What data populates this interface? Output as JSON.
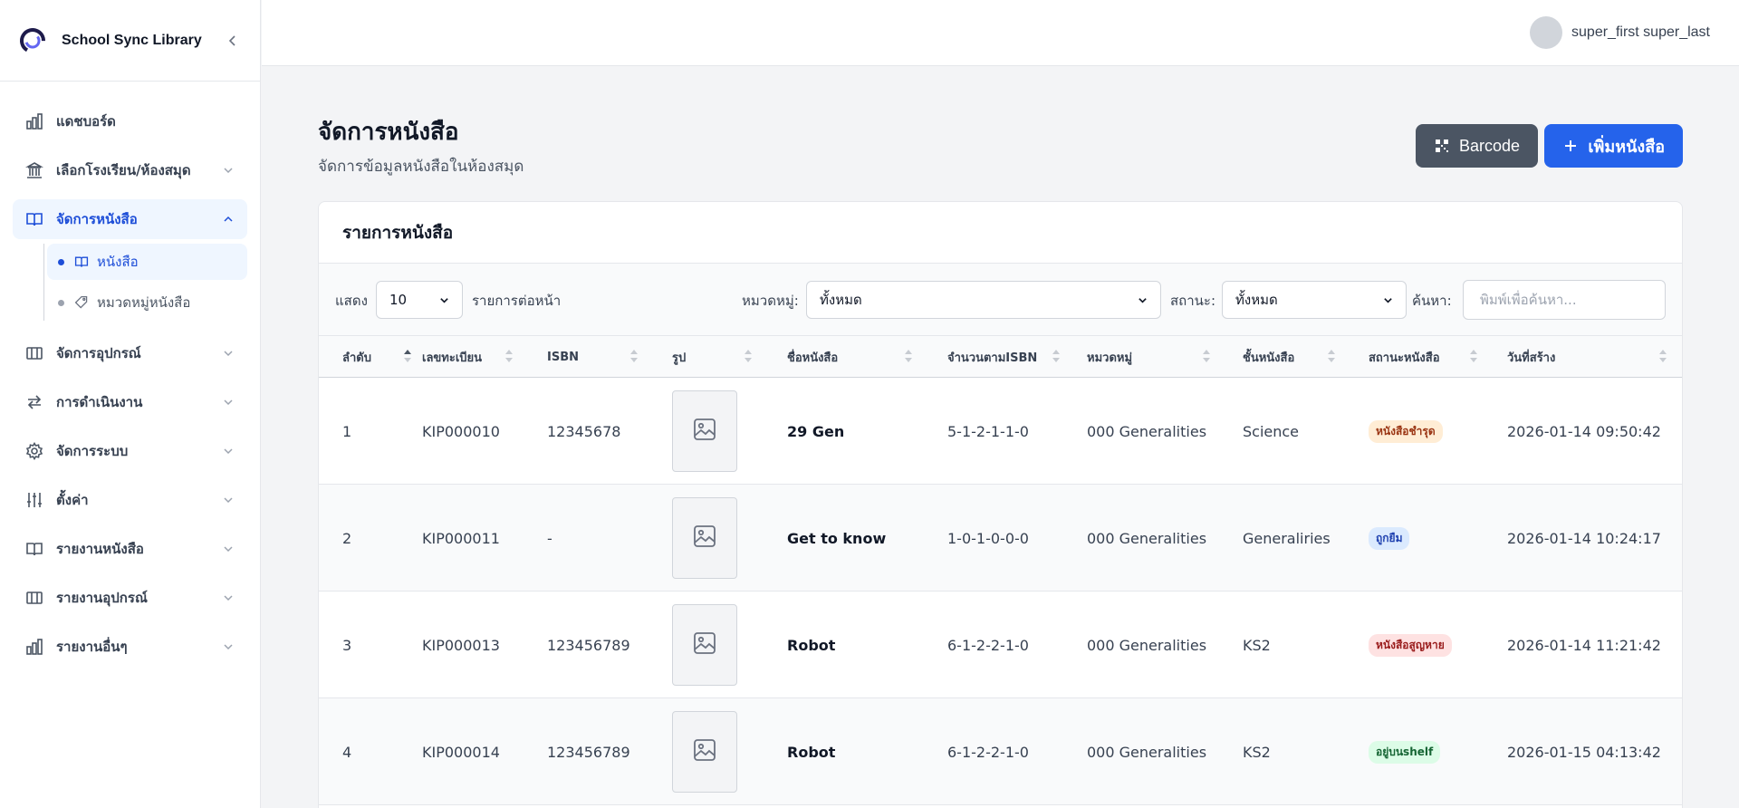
{
  "app": {
    "name": "School Sync Library"
  },
  "user": {
    "name": "super_first super_last"
  },
  "sidebar": {
    "items": [
      {
        "label": "แดชบอร์ด"
      },
      {
        "label": "เลือกโรงเรียน/ห้องสมุด"
      },
      {
        "label": "จัดการหนังสือ",
        "sub": [
          {
            "label": "หนังสือ"
          },
          {
            "label": "หมวดหมู่หนังสือ"
          }
        ]
      },
      {
        "label": "จัดการอุปกรณ์"
      },
      {
        "label": "การดำเนินงาน"
      },
      {
        "label": "จัดการระบบ"
      },
      {
        "label": "ตั้งค่า"
      },
      {
        "label": "รายงานหนังสือ"
      },
      {
        "label": "รายงานอุปกรณ์"
      },
      {
        "label": "รายงานอื่นๆ"
      }
    ]
  },
  "page": {
    "title": "จัดการหนังสือ",
    "subtitle": "จัดการข้อมูลหนังสือในห้องสมุด",
    "barcode_label": "Barcode",
    "add_label": "เพิ่มหนังสือ"
  },
  "card": {
    "title": "รายการหนังสือ",
    "filters": {
      "show_label": "แสดง",
      "per_page": "10",
      "per_page_suffix": "รายการต่อหน้า",
      "category_label": "หมวดหมู่:",
      "category_value": "ทั้งหมด",
      "status_label": "สถานะ:",
      "status_value": "ทั้งหมด",
      "search_label": "ค้นหา:",
      "search_placeholder": "พิมพ์เพื่อค้นหา..."
    },
    "columns": [
      "ลำดับ",
      "เลขทะเบียน",
      "ISBN",
      "รูป",
      "ชื่อหนังสือ",
      "จำนวนตามISBN",
      "หมวดหมู่",
      "ชั้นหนังสือ",
      "สถานะหนังสือ",
      "วันที่สร้าง"
    ],
    "rows": [
      {
        "no": "1",
        "reg": "KIP000010",
        "isbn": "12345678",
        "name": "29 Gen",
        "count": "5-1-2-1-1-0",
        "category": "000 Generalities",
        "shelf": "Science",
        "status": "หนังสือชำรุด",
        "created": "2026-01-14 09:50:42"
      },
      {
        "no": "2",
        "reg": "KIP000011",
        "isbn": "-",
        "name": "Get to know",
        "count": "1-0-1-0-0-0",
        "category": "000 Generalities",
        "shelf": "Generaliries",
        "status": "ถูกยืม",
        "created": "2026-01-14 10:24:17"
      },
      {
        "no": "3",
        "reg": "KIP000013",
        "isbn": "123456789",
        "name": "Robot",
        "count": "6-1-2-2-1-0",
        "category": "000 Generalities",
        "shelf": "KS2",
        "status": "หนังสือสูญหาย",
        "created": "2026-01-14 11:21:42"
      },
      {
        "no": "4",
        "reg": "KIP000014",
        "isbn": "123456789",
        "name": "Robot",
        "count": "6-1-2-2-1-0",
        "category": "000 Generalities",
        "shelf": "KS2",
        "status": "อยู่บนshelf",
        "created": "2026-01-15 04:13:42"
      }
    ]
  },
  "colors": {
    "primary": "#2563eb",
    "active_bg": "#eff6ff",
    "barcode_btn": "#4b5563"
  }
}
